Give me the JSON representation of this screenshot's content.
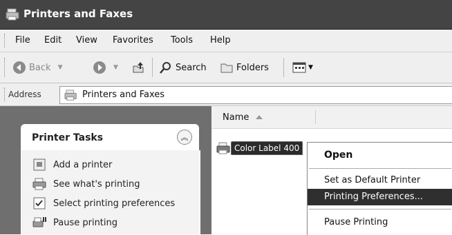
{
  "window": {
    "title": "Printers and Faxes"
  },
  "menu": [
    "File",
    "Edit",
    "View",
    "Favorites",
    "Tools",
    "Help"
  ],
  "toolbar": {
    "back": "Back",
    "search": "Search",
    "folders": "Folders"
  },
  "address": {
    "label": "Address",
    "value": "Printers and Faxes"
  },
  "tasks": {
    "title": "Printer Tasks",
    "items": [
      "Add a printer",
      "See what's printing",
      "Select printing preferences",
      "Pause printing"
    ]
  },
  "list": {
    "column": "Name",
    "items": [
      "Color Label 400"
    ]
  },
  "context_menu": {
    "items": [
      "Open",
      "Set as Default Printer",
      "Printing Preferences...",
      "Pause Printing"
    ],
    "highlighted_index": 2
  }
}
